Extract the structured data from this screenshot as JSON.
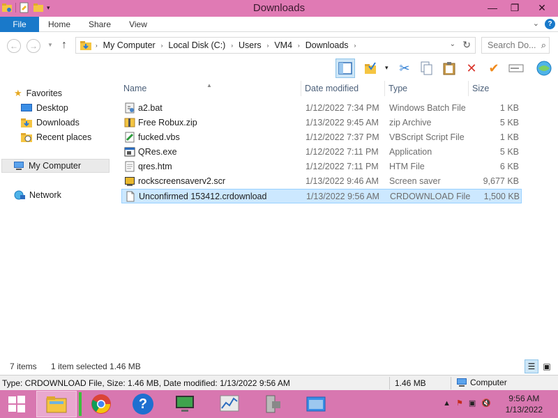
{
  "window": {
    "title": "Downloads",
    "minimize_glyph": "—",
    "restore_glyph": "❐",
    "close_glyph": "✕"
  },
  "ribbon": {
    "tabs": [
      "File",
      "Home",
      "Share",
      "View"
    ],
    "help_glyph": "?"
  },
  "address": {
    "crumbs": [
      "My Computer",
      "Local Disk (C:)",
      "Users",
      "VM4",
      "Downloads"
    ],
    "search_placeholder": "Search Do..."
  },
  "navigation": {
    "favorites_label": "Favorites",
    "favorites": [
      "Desktop",
      "Downloads",
      "Recent places"
    ],
    "computer_label": "My Computer",
    "network_label": "Network"
  },
  "columns": {
    "name": "Name",
    "date": "Date modified",
    "type": "Type",
    "size": "Size"
  },
  "files": [
    {
      "name": "a2.bat",
      "date": "1/12/2022 7:34 PM",
      "type": "Windows Batch File",
      "size": "1 KB",
      "icon": "batch-file-icon"
    },
    {
      "name": "Free Robux.zip",
      "date": "1/13/2022 9:45 AM",
      "type": "zip Archive",
      "size": "5 KB",
      "icon": "zip-file-icon"
    },
    {
      "name": "fucked.vbs",
      "date": "1/12/2022 7:37 PM",
      "type": "VBScript Script File",
      "size": "1 KB",
      "icon": "script-file-icon"
    },
    {
      "name": "QRes.exe",
      "date": "1/12/2022 7:11 PM",
      "type": "Application",
      "size": "5 KB",
      "icon": "application-icon"
    },
    {
      "name": "qres.htm",
      "date": "1/12/2022 7:11 PM",
      "type": "HTM File",
      "size": "6 KB",
      "icon": "htm-file-icon"
    },
    {
      "name": "rockscreensaverv2.scr",
      "date": "1/13/2022 9:46 AM",
      "type": "Screen saver",
      "size": "9,677 KB",
      "icon": "screensaver-icon"
    },
    {
      "name": "Unconfirmed 153412.crdownload",
      "date": "1/13/2022 9:56 AM",
      "type": "CRDOWNLOAD File",
      "size": "1,500 KB",
      "icon": "blank-file-icon"
    }
  ],
  "selected_index": 6,
  "status": {
    "item_count": "7 items",
    "selection": "1 item selected  1.46 MB"
  },
  "details_bar": {
    "text": "Type: CRDOWNLOAD File, Size: 1.46 MB, Date modified: 1/13/2022 9:56 AM",
    "size": "1.46 MB",
    "location": "Computer"
  },
  "taskbar": {
    "time": "9:56 AM",
    "date": "1/13/2022"
  },
  "colors": {
    "titlebar": "#e07ab4",
    "taskbar": "#d877b0",
    "file_tab": "#1979ca",
    "selection": "#cce8ff"
  }
}
